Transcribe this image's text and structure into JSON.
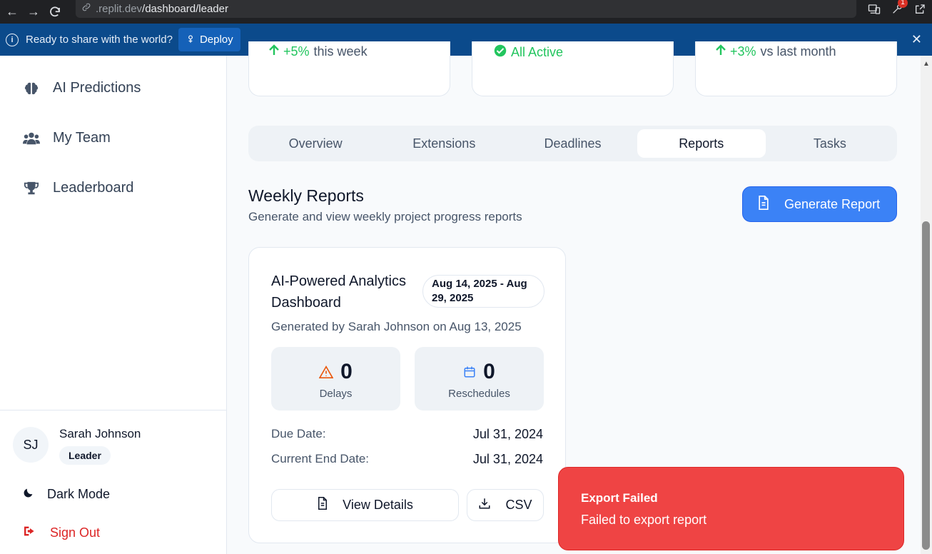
{
  "browser": {
    "url_dim": ".replit.dev",
    "url_path": "/dashboard/leader",
    "notification_count": "1"
  },
  "banner": {
    "text": "Ready to share with the world?",
    "deploy_label": "Deploy"
  },
  "sidebar": {
    "items": [
      {
        "label": "AI Predictions",
        "icon": "brain-icon"
      },
      {
        "label": "My Team",
        "icon": "users-icon"
      },
      {
        "label": "Leaderboard",
        "icon": "trophy-icon"
      }
    ],
    "user": {
      "initials": "SJ",
      "name": "Sarah Johnson",
      "role": "Leader"
    },
    "dark_mode_label": "Dark Mode",
    "sign_out_label": "Sign Out"
  },
  "stats": [
    {
      "change": "+5%",
      "suffix": "this week"
    },
    {
      "change": "All Active",
      "suffix": ""
    },
    {
      "change": "+3%",
      "suffix": "vs last month"
    }
  ],
  "tabs": [
    "Overview",
    "Extensions",
    "Deadlines",
    "Reports",
    "Tasks"
  ],
  "active_tab": "Reports",
  "reports": {
    "title": "Weekly Reports",
    "subtitle": "Generate and view weekly project progress reports",
    "generate_label": "Generate Report",
    "card": {
      "title": "AI-Powered Analytics Dashboard",
      "date_range": "Aug 14, 2025 - Aug 29, 2025",
      "generated": "Generated by Sarah Johnson on Aug 13, 2025",
      "delays_value": "0",
      "delays_label": "Delays",
      "reschedules_value": "0",
      "reschedules_label": "Reschedules",
      "due_label": "Due Date:",
      "due_value": "Jul 31, 2024",
      "end_label": "Current End Date:",
      "end_value": "Jul 31, 2024",
      "view_label": "View Details",
      "csv_label": "CSV"
    }
  },
  "toast": {
    "title": "Export Failed",
    "message": "Failed to export report"
  },
  "colors": {
    "accent": "#3b82f6",
    "success": "#22c55e",
    "danger": "#ef4444",
    "banner": "#0b4a8b"
  }
}
